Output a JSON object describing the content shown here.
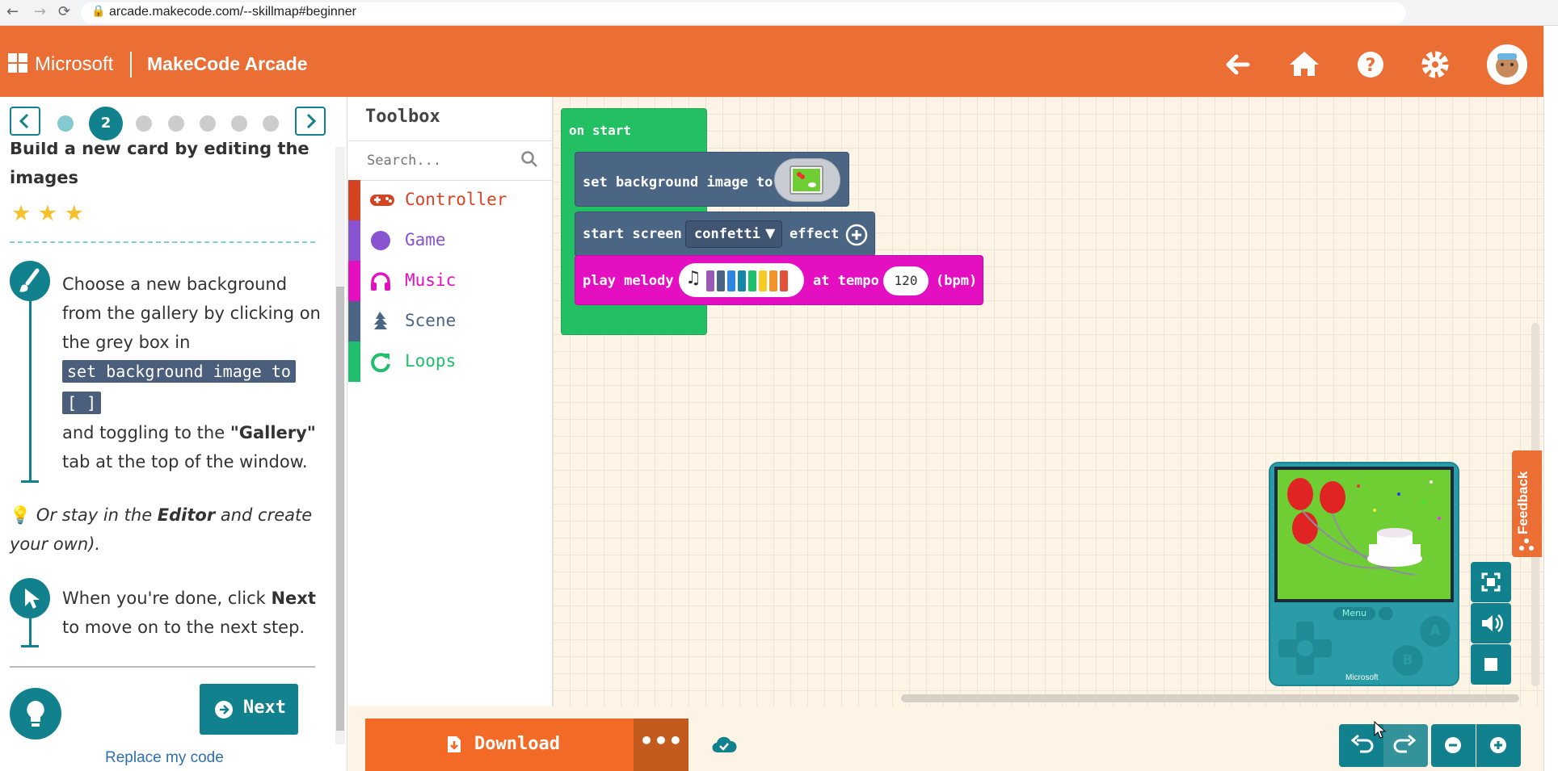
{
  "browser": {
    "url": "arcade.makecode.com/--skillmap#beginner"
  },
  "header": {
    "brand_ms": "Microsoft",
    "brand_app": "MakeCode Arcade",
    "icons": [
      "arrow-left-icon",
      "home-icon",
      "help-icon",
      "gear-icon",
      "avatar"
    ]
  },
  "tutorial": {
    "step_current": "2",
    "title": "Build a new card by editing the images",
    "stars": "★ ★ ★",
    "p1_l1": "Choose a new background",
    "p1_l2": "from the gallery by clicking on",
    "p1_l3": "the grey box in",
    "code1": "set background image to",
    "code2": "[ ]",
    "p1_l4a": "and toggling to the ",
    "p1_l4b": "\"Gallery\"",
    "p1_l5": "tab at the top of the window.",
    "tip_a": "Or stay in the ",
    "tip_b": "Editor",
    "tip_c": " and create",
    "tip_d": "your own).",
    "p2_l1a": "When you're done, click ",
    "p2_l1b": "Next",
    "p2_l2": "to move on to the next step.",
    "next_label": "Next",
    "replace_label": "Replace my code"
  },
  "toolbox": {
    "title": "Toolbox",
    "search_placeholder": "Search...",
    "categories": [
      {
        "label": "Controller",
        "color": "#d54322"
      },
      {
        "label": "Game",
        "color": "#8854d0"
      },
      {
        "label": "Music",
        "color": "#e30fc0"
      },
      {
        "label": "Scene",
        "color": "#4b6584"
      },
      {
        "label": "Loops",
        "color": "#20bf6b"
      }
    ]
  },
  "blocks": {
    "on_start": "on start",
    "set_bg": "set background image to",
    "start_screen": "start screen",
    "effect_value": "confetti",
    "effect": "effect",
    "play_melody": "play melody",
    "at_tempo": "at tempo",
    "tempo_value": "120",
    "bpm": "(bpm)"
  },
  "simulator": {
    "menu": "Menu",
    "btn_a": "A",
    "btn_b": "B",
    "brand": "Microsoft"
  },
  "bottom": {
    "download": "Download",
    "more": "•••"
  },
  "feedback": "Feedback",
  "colors": {
    "header": "#eb6f35",
    "teal": "#12818e",
    "workspace": "#fdf4e6"
  }
}
